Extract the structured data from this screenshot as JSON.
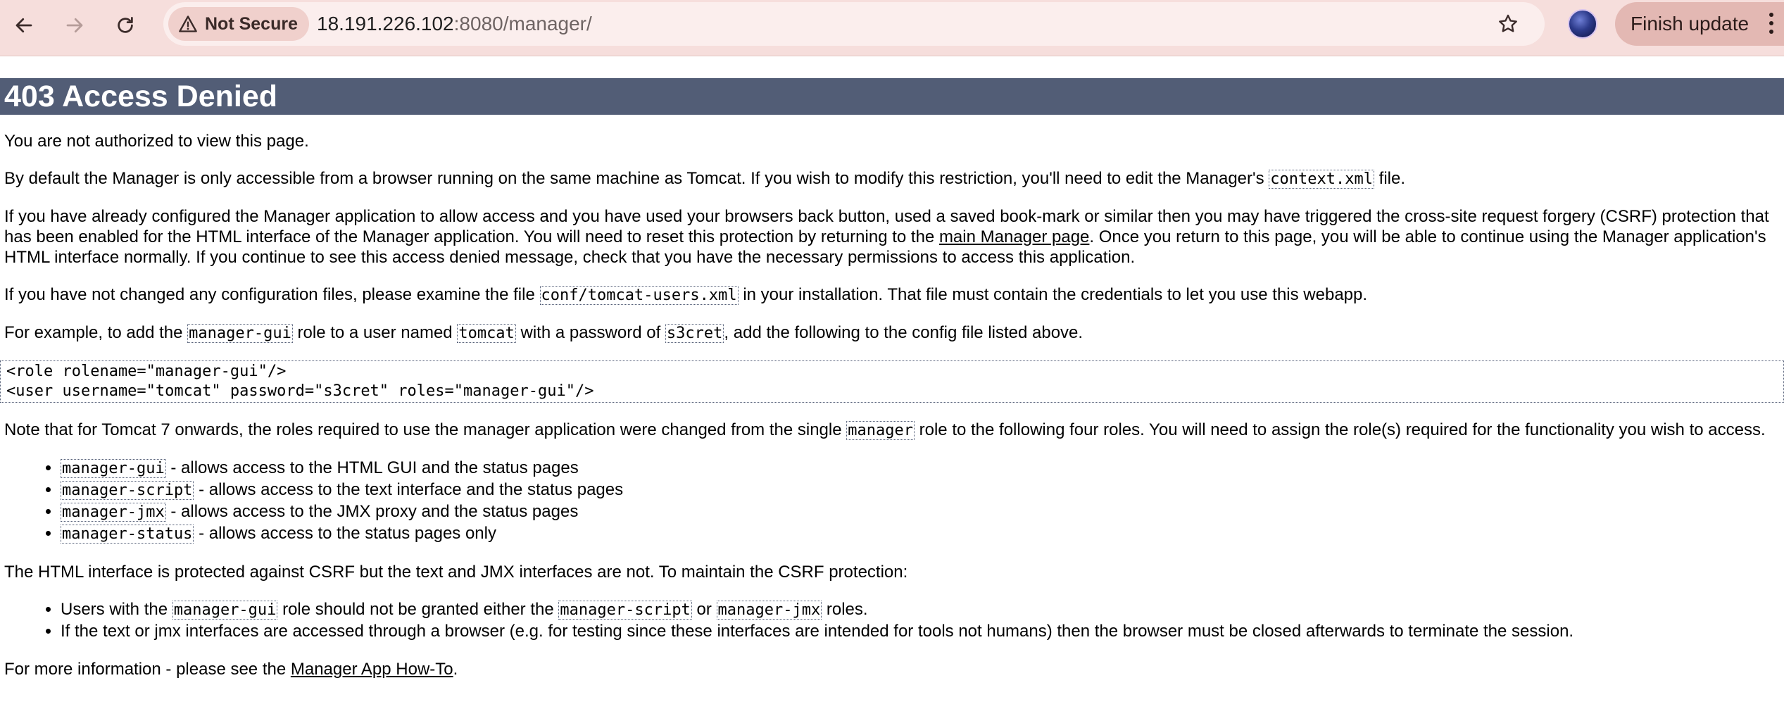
{
  "browser": {
    "security_label": "Not Secure",
    "url_host": "18.191.226.102",
    "url_rest": ":8080/manager/",
    "finish_update_label": "Finish update",
    "icons": {
      "back": "arrow-left-icon",
      "forward": "arrow-right-icon",
      "reload": "reload-icon",
      "warning": "warning-triangle-icon",
      "bookmark": "star-icon",
      "menu": "vertical-dots-icon"
    }
  },
  "page": {
    "title": "403 Access Denied",
    "p_not_authorized": "You are not authorized to view this page.",
    "p_default": {
      "before": "By default the Manager is only accessible from a browser running on the same machine as Tomcat. If you wish to modify this restriction, you'll need to edit the Manager's ",
      "code": "context.xml",
      "after": " file."
    },
    "p_csrf": {
      "before": "If you have already configured the Manager application to allow access and you have used your browsers back button, used a saved book-mark or similar then you may have triggered the cross-site request forgery (CSRF) protection that has been enabled for the HTML interface of the Manager application. You will need to reset this protection by returning to the ",
      "link": "main Manager page",
      "after": ". Once you return to this page, you will be able to continue using the Manager application's HTML interface normally. If you continue to see this access denied message, check that you have the necessary permissions to access this application."
    },
    "p_config": {
      "before": "If you have not changed any configuration files, please examine the file ",
      "code": "conf/tomcat-users.xml",
      "after": " in your installation. That file must contain the credentials to let you use this webapp."
    },
    "p_example": {
      "t1": "For example, to add the ",
      "c1": "manager-gui",
      "t2": " role to a user named ",
      "c2": "tomcat",
      "t3": " with a password of ",
      "c3": "s3cret",
      "t4": ", add the following to the config file listed above."
    },
    "code_block": "<role rolename=\"manager-gui\"/>\n<user username=\"tomcat\" password=\"s3cret\" roles=\"manager-gui\"/>",
    "p_note": {
      "before": "Note that for Tomcat 7 onwards, the roles required to use the manager application were changed from the single ",
      "code": "manager",
      "after": " role to the following four roles. You will need to assign the role(s) required for the functionality you wish to access."
    },
    "roles": [
      {
        "code": "manager-gui",
        "text": " - allows access to the HTML GUI and the status pages"
      },
      {
        "code": "manager-script",
        "text": " - allows access to the text interface and the status pages"
      },
      {
        "code": "manager-jmx",
        "text": " - allows access to the JMX proxy and the status pages"
      },
      {
        "code": "manager-status",
        "text": " - allows access to the status pages only"
      }
    ],
    "p_html_interface": "The HTML interface is protected against CSRF but the text and JMX interfaces are not. To maintain the CSRF protection:",
    "csrf_list": {
      "item1": {
        "t1": "Users with the ",
        "c1": "manager-gui",
        "t2": " role should not be granted either the ",
        "c2": "manager-script",
        "t3": " or ",
        "c3": "manager-jmx",
        "t4": " roles."
      },
      "item2": "If the text or jmx interfaces are accessed through a browser (e.g. for testing since these interfaces are intended for tools not humans) then the browser must be closed afterwards to terminate the session."
    },
    "p_more": {
      "before": "For more information - please see the ",
      "link": "Manager App How-To",
      "after": "."
    }
  }
}
